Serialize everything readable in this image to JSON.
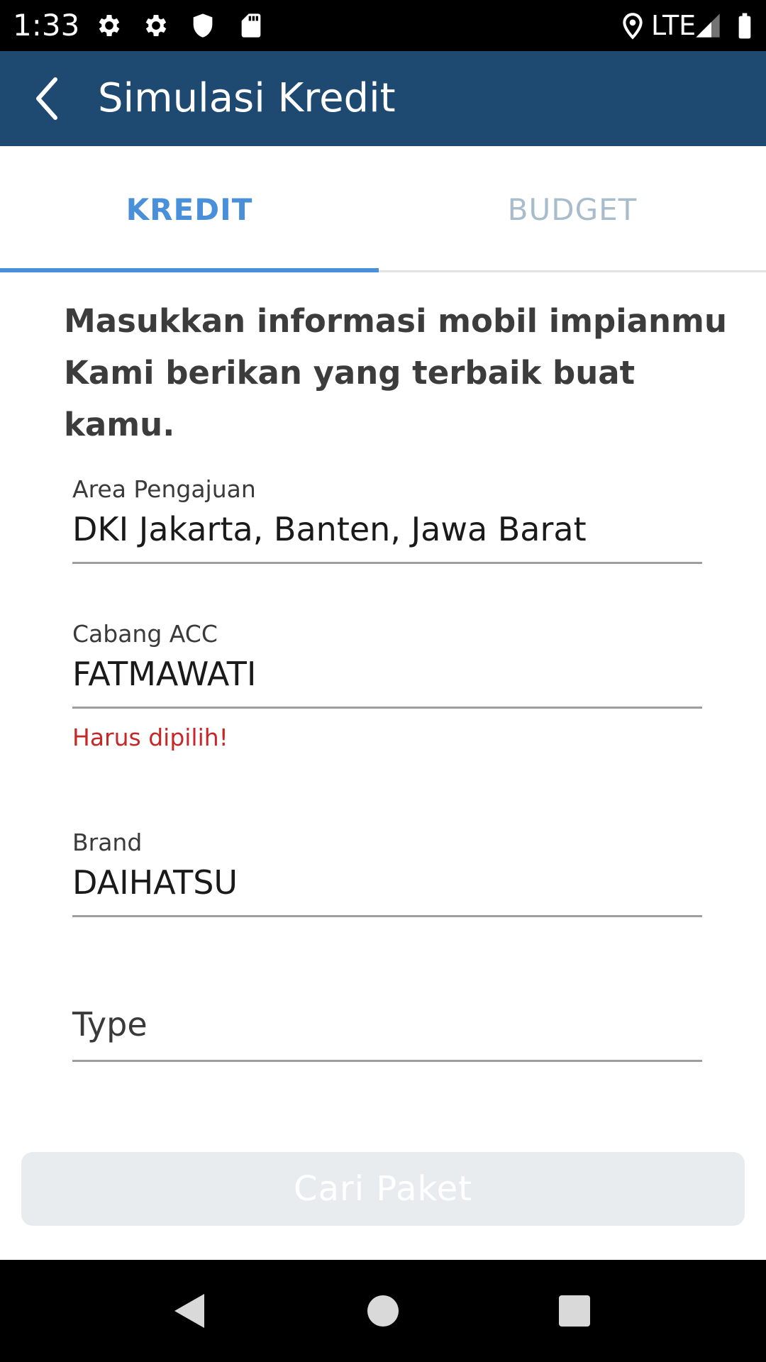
{
  "status_bar": {
    "time": "1:33",
    "network": "LTE",
    "icons": [
      "gear-icon",
      "gear-icon",
      "shield-icon",
      "sd-card-icon",
      "location-pin-icon",
      "signal-icon",
      "battery-icon"
    ]
  },
  "app_bar": {
    "title": "Simulasi Kredit",
    "back_icon": "chevron-left-icon",
    "background": "#1e4a72"
  },
  "tabs": [
    {
      "label": "KREDIT",
      "active": true,
      "color": "#4a8fd9"
    },
    {
      "label": "BUDGET",
      "active": false,
      "color": "#a9bccc"
    }
  ],
  "intro": {
    "line1": "Masukkan informasi mobil impianmu",
    "line2": "Kami berikan yang terbaik buat kamu."
  },
  "form": {
    "area": {
      "label": "Area Pengajuan",
      "value": "DKI Jakarta, Banten, Jawa Barat"
    },
    "cabang": {
      "label": "Cabang ACC",
      "value": "FATMAWATI",
      "error": "Harus dipilih!"
    },
    "brand": {
      "label": "Brand",
      "value": "DAIHATSU"
    },
    "type": {
      "placeholder": "Type"
    }
  },
  "button": {
    "label": "Cari Paket",
    "enabled": false
  },
  "nav_bar": {
    "icons": [
      "back-triangle-icon",
      "home-circle-icon",
      "recents-square-icon"
    ]
  }
}
